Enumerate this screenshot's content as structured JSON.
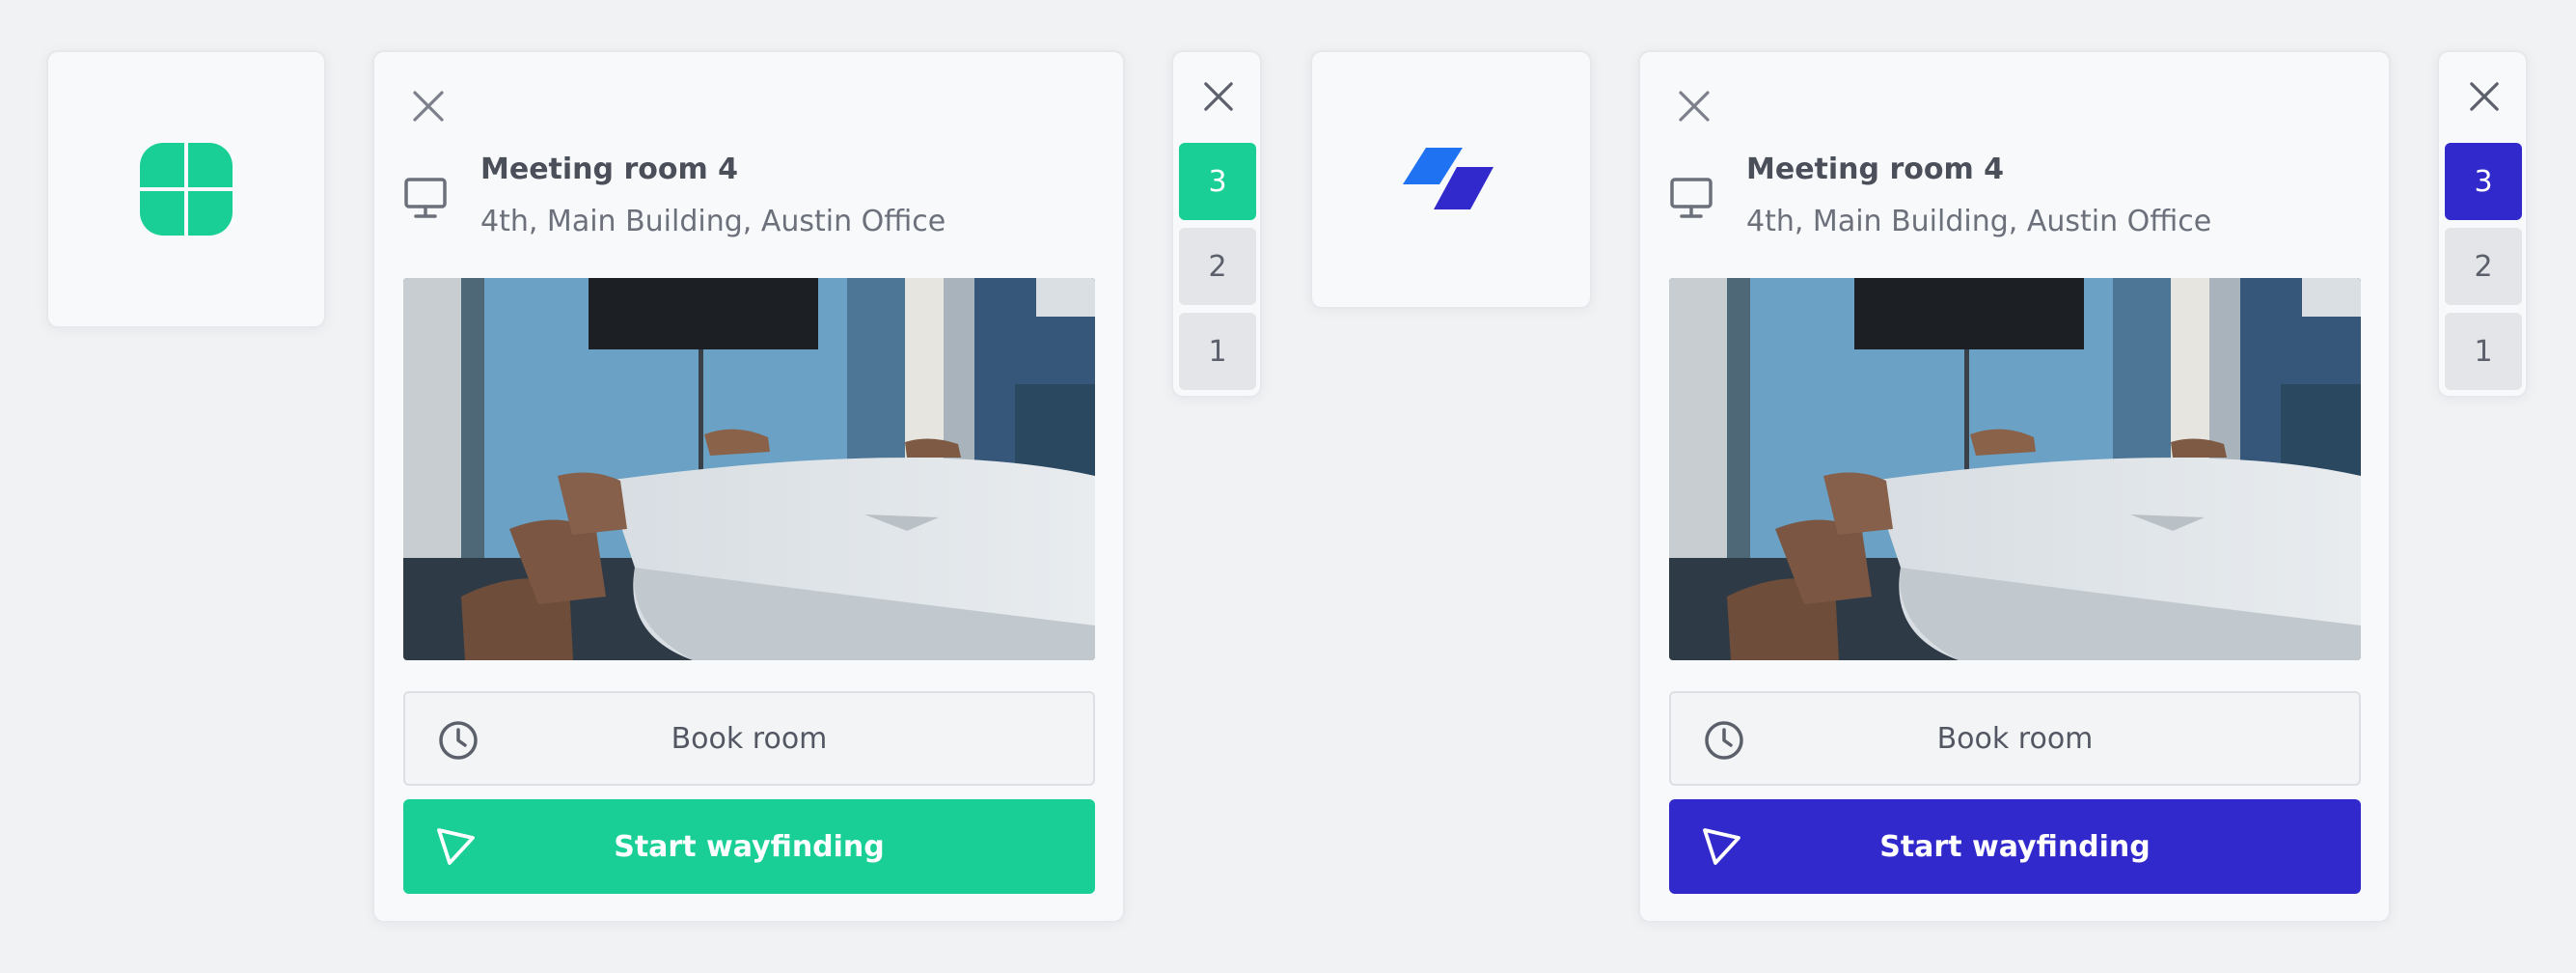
{
  "variants": [
    {
      "accent": "#19cf96",
      "logo_icon": "green-clover-logo-icon",
      "panel": {
        "close_icon": "close-icon",
        "room_icon": "monitor-icon",
        "room_name": "Meeting room 4",
        "room_location": "4th, Main Building, Austin Office",
        "image": "meeting-room-photo",
        "book_label": "Book room",
        "book_icon": "clock-icon",
        "wayfinding_label": "Start wayfinding",
        "wayfinding_icon": "navigation-arrow-icon"
      },
      "floors": {
        "close_icon": "close-icon",
        "items": [
          "3",
          "2",
          "1"
        ],
        "selected": "3"
      }
    },
    {
      "accent": "#3129cc",
      "logo_icon": "blue-parallelogram-logo-icon",
      "panel": {
        "close_icon": "close-icon",
        "room_icon": "monitor-icon",
        "room_name": "Meeting room 4",
        "room_location": "4th, Main Building, Austin Office",
        "image": "meeting-room-photo",
        "book_label": "Book room",
        "book_icon": "clock-icon",
        "wayfinding_label": "Start wayfinding",
        "wayfinding_icon": "navigation-arrow-icon"
      },
      "floors": {
        "close_icon": "close-icon",
        "items": [
          "3",
          "2",
          "1"
        ],
        "selected": "3"
      }
    }
  ]
}
